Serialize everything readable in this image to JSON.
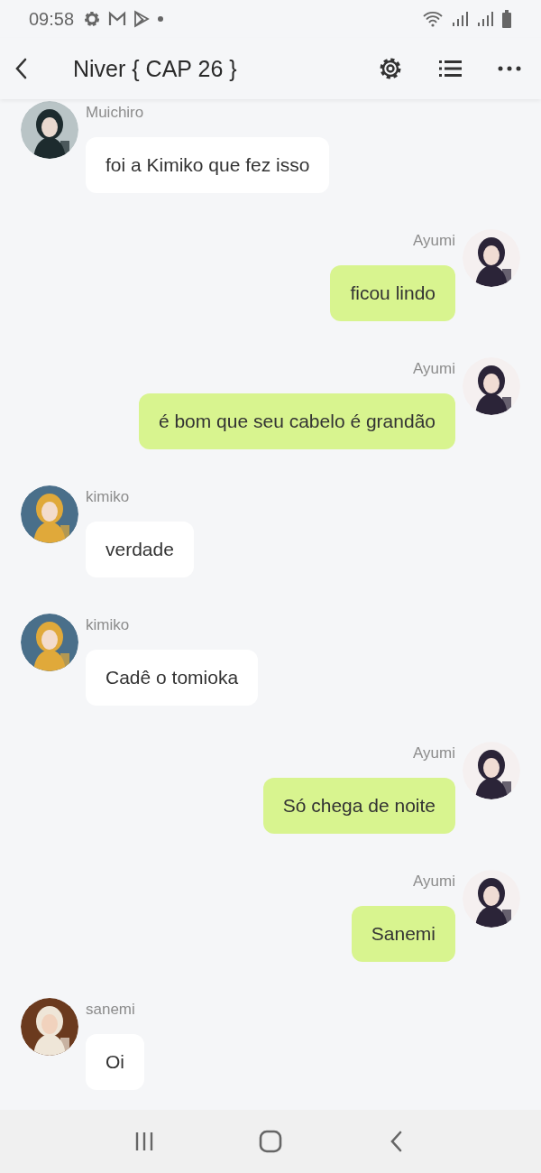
{
  "status_bar": {
    "time": "09:58"
  },
  "header": {
    "title": "Niver { CAP 26 }"
  },
  "messages": [
    {
      "kind": "received",
      "sender": "Muichiro",
      "text": "foi a Kimiko que fez isso"
    },
    {
      "kind": "sent",
      "sender": "Ayumi",
      "text": "ficou lindo"
    },
    {
      "kind": "sent",
      "sender": "Ayumi",
      "text": "é bom que seu cabelo é grandão"
    },
    {
      "kind": "received",
      "sender": "kimiko",
      "text": "verdade"
    },
    {
      "kind": "received",
      "sender": "kimiko",
      "text": "Cadê o tomioka"
    },
    {
      "kind": "sent",
      "sender": "Ayumi",
      "text": "Só chega de noite"
    },
    {
      "kind": "sent",
      "sender": "Ayumi",
      "text": "Sanemi"
    },
    {
      "kind": "received",
      "sender": "sanemi",
      "text": "Oi"
    }
  ]
}
